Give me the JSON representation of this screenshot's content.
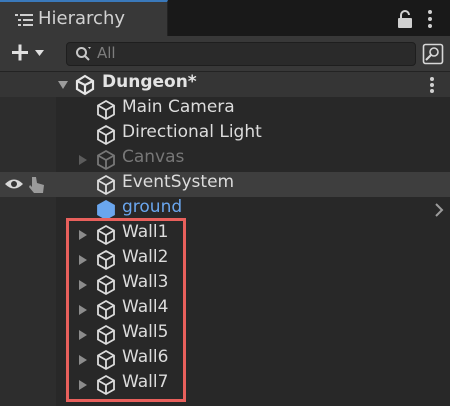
{
  "window": {
    "tab_title": "Hierarchy"
  },
  "toolbar": {
    "search_placeholder": "All"
  },
  "scene": {
    "name": "Dungeon*"
  },
  "objects": [
    {
      "label": "Main Camera",
      "state": "normal",
      "has_children": false
    },
    {
      "label": "Directional Light",
      "state": "normal",
      "has_children": false
    },
    {
      "label": "Canvas",
      "state": "inactive",
      "has_children": true
    },
    {
      "label": "EventSystem",
      "state": "selected",
      "has_children": false
    },
    {
      "label": "ground",
      "state": "prefab",
      "has_children": false
    },
    {
      "label": "Wall1",
      "state": "normal",
      "has_children": true
    },
    {
      "label": "Wall2",
      "state": "normal",
      "has_children": true
    },
    {
      "label": "Wall3",
      "state": "normal",
      "has_children": true
    },
    {
      "label": "Wall4",
      "state": "normal",
      "has_children": true
    },
    {
      "label": "Wall5",
      "state": "normal",
      "has_children": true
    },
    {
      "label": "Wall6",
      "state": "normal",
      "has_children": true
    },
    {
      "label": "Wall7",
      "state": "normal",
      "has_children": true
    }
  ],
  "colors": {
    "highlight_box": "#e8605c",
    "prefab_text": "#6aa6ee",
    "tab_accent": "#3a79bb"
  }
}
